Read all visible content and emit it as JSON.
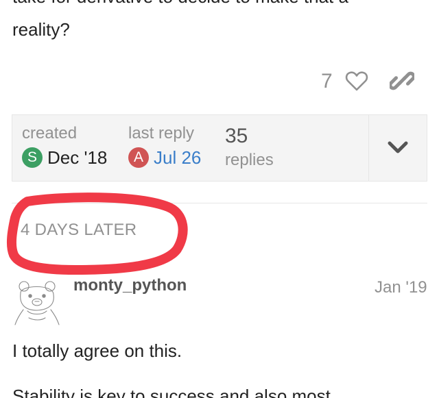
{
  "previous_post": {
    "line1": "take for derivative to decide to make that a",
    "line2": "reality?"
  },
  "post_actions": {
    "like_count": "7",
    "icons": [
      "heart-icon",
      "link-icon"
    ]
  },
  "topic_map": {
    "created_label": "created",
    "created_avatar_letter": "S",
    "created_avatar_color": "#3c9f63",
    "created_date": "Dec '18",
    "last_reply_label": "last reply",
    "last_reply_avatar_letter": "A",
    "last_reply_avatar_color": "#d05454",
    "last_reply_date": "Jul 26",
    "last_reply_date_color": "#3a7ec9",
    "replies_count": "35",
    "replies_label": "replies",
    "expand_icon": "chevron-down-icon"
  },
  "time_gap": {
    "label": "4 DAYS LATER",
    "highlight_color": "#f03a47"
  },
  "post": {
    "username": "monty_python",
    "date": "Jan '19",
    "avatar_icon": "bear-sketch-avatar",
    "body_line1": "I totally agree on this.",
    "body_line2": "Stability is key to success and also most"
  }
}
